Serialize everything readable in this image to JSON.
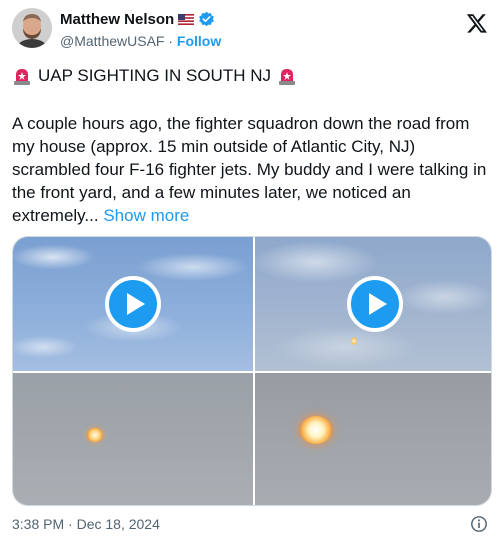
{
  "author": {
    "display_name": "Matthew Nelson",
    "handle": "@MatthewUSAF",
    "separator": "·",
    "follow_label": "Follow",
    "flag_icon": "us-flag-icon",
    "verified_icon": "verified-badge-icon"
  },
  "brand": {
    "logo_icon": "x-logo-icon"
  },
  "tweet": {
    "headline": "UAP SIGHTING IN SOUTH NJ",
    "headline_icon": "rotating-light-icon",
    "body": "A couple hours ago, the fighter squadron down the road from my house (approx. 15 min outside of Atlantic City, NJ) scrambled four F-16 fighter jets. My buddy and I were talking in the front yard, and a few minutes later, we noticed an extremely...",
    "show_more_label": "Show more"
  },
  "media": {
    "count": 4,
    "items": [
      {
        "kind": "video",
        "scene": "blue sky with clouds"
      },
      {
        "kind": "video",
        "scene": "blue sky with small light"
      },
      {
        "kind": "image",
        "scene": "grey sky with glowing orb"
      },
      {
        "kind": "image",
        "scene": "grey sky with large glowing orb"
      }
    ]
  },
  "footer": {
    "timestamp": "3:38 PM · Dec 18, 2024",
    "info_icon": "info-icon"
  },
  "colors": {
    "accent": "#1d9bf0",
    "text": "#0f1419",
    "muted": "#536471",
    "siren_red": "#e0245e"
  }
}
